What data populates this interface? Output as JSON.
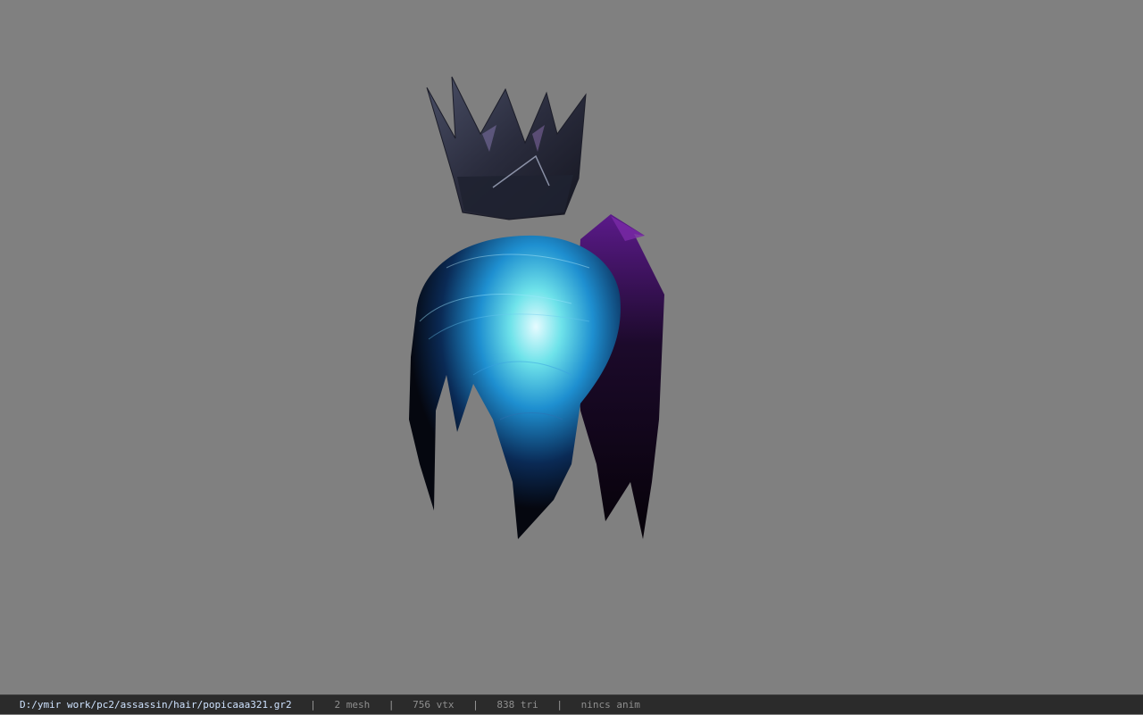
{
  "viewer": {
    "background_color": "#808080",
    "model": {
      "objects": [
        "crown-mesh",
        "hair-mesh"
      ]
    }
  },
  "statusbar": {
    "file_path": "D:/ymir work/pc2/assassin/hair/popicaaa321.gr2",
    "separator": "|",
    "mesh_count": "2 mesh",
    "vertex_count": "756 vtx",
    "triangle_count": "838 tri",
    "anim_status": "nincs anim"
  }
}
